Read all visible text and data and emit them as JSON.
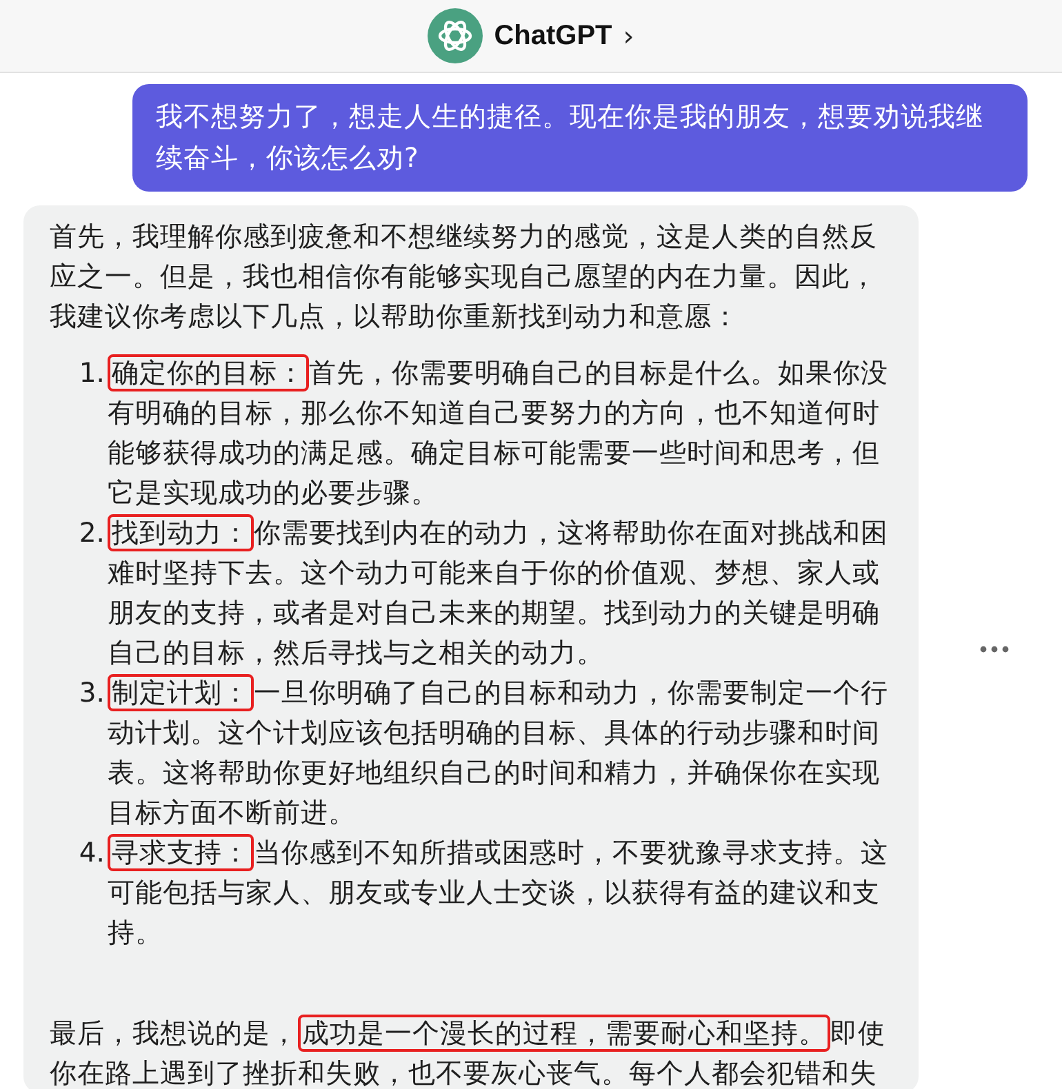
{
  "header": {
    "title": "ChatGPT",
    "chevron": "›"
  },
  "user_message": "我不想努力了，想走人生的捷径。现在你是我的朋友，想要劝说我继续奋斗，你该怎么劝?",
  "assistant_message": {
    "intro": "首先，我理解你感到疲惫和不想继续努力的感觉，这是人类的自然反应之一。但是，我也相信你有能够实现自己愿望的内在力量。因此，我建议你考虑以下几点，以帮助你重新找到动力和意愿：",
    "items": [
      {
        "number": "1.",
        "label": "确定你的目标：",
        "highlighted": true,
        "text": "首先，你需要明确自己的目标是什么。如果你没有明确的目标，那么你不知道自己要努力的方向，也不知道何时能够获得成功的满足感。确定目标可能需要一些时间和思考，但它是实现成功的必要步骤。"
      },
      {
        "number": "2.",
        "label": "找到动力：",
        "highlighted": true,
        "text": "你需要找到内在的动力，这将帮助你在面对挑战和困难时坚持下去。这个动力可能来自于你的价值观、梦想、家人或朋友的支持，或者是对自己未来的期望。找到动力的关键是明确自己的目标，然后寻找与之相关的动力。"
      },
      {
        "number": "3.",
        "label": "制定计划：",
        "highlighted": true,
        "text": "一旦你明确了自己的目标和动力，你需要制定一个行动计划。这个计划应该包括明确的目标、具体的行动步骤和时间表。这将帮助你更好地组织自己的时间和精力，并确保你在实现目标方面不断前进。"
      },
      {
        "number": "4.",
        "label": "寻求支持：",
        "highlighted": true,
        "text": "当你感到不知所措或困惑时，不要犹豫寻求支持。这可能包括与家人、朋友或专业人士交谈，以获得有益的建议和支持。"
      }
    ],
    "closing": [
      {
        "text": "最后，我想说的是，",
        "highlighted": false
      },
      {
        "text": "成功是一个漫长的过程，需要耐心和坚持。",
        "highlighted": true
      },
      {
        "text": "即使你在路上遇到了挫折和失败，也不要灰心丧气。每个人都会犯错和失",
        "highlighted": false
      }
    ]
  }
}
